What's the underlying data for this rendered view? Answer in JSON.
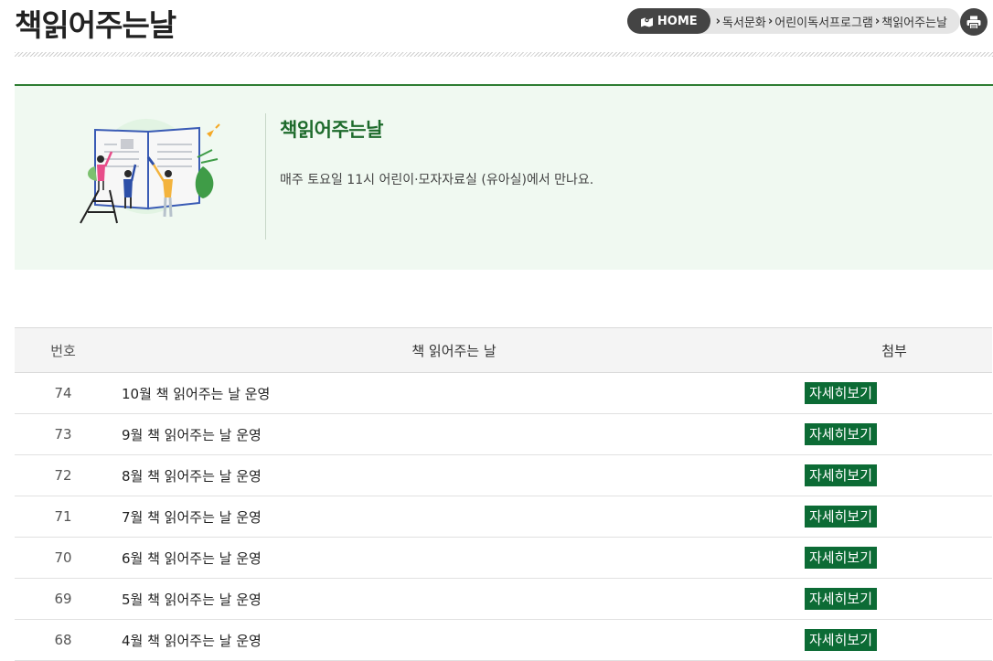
{
  "page": {
    "title": "책읽어주는날"
  },
  "breadcrumb": {
    "home": "HOME",
    "items": [
      "독서문화",
      "어린이독서프로그램",
      "책읽어주는날"
    ]
  },
  "intro": {
    "title": "책읽어주는날",
    "description": "매주 토요일 11시 어린이·모자자료실 (유아실)에서 만나요."
  },
  "table": {
    "headers": {
      "num": "번호",
      "title": "책 읽어주는 날",
      "attach": "첨부"
    },
    "rows": [
      {
        "num": "74",
        "title": "10월 책 읽어주는 날 운영",
        "action": "자세히보기"
      },
      {
        "num": "73",
        "title": "9월 책 읽어주는 날 운영",
        "action": "자세히보기"
      },
      {
        "num": "72",
        "title": "8월 책 읽어주는 날 운영",
        "action": "자세히보기"
      },
      {
        "num": "71",
        "title": "7월 책 읽어주는 날 운영",
        "action": "자세히보기"
      },
      {
        "num": "70",
        "title": "6월 책 읽어주는 날 운영",
        "action": "자세히보기"
      },
      {
        "num": "69",
        "title": "5월 책 읽어주는 날 운영",
        "action": "자세히보기"
      },
      {
        "num": "68",
        "title": "4월 책 읽어주는 날 운영",
        "action": "자세히보기"
      }
    ]
  },
  "colors": {
    "accent": "#0c6b35",
    "intro_bg": "#f0f9f1",
    "title_green": "#1e6b2c"
  },
  "icons": {
    "home": "map-marker-icon",
    "separator": "chevron-right-icon",
    "print": "printer-icon"
  }
}
